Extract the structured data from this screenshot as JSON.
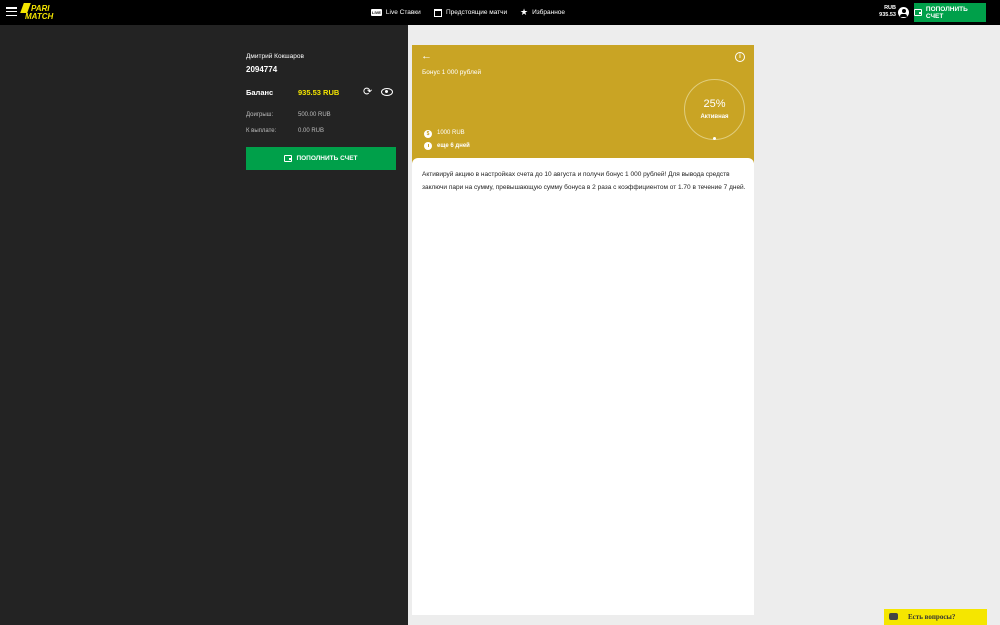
{
  "header": {
    "logo_line1": "PARI",
    "logo_line2": "MATCH",
    "nav": [
      {
        "label": "Live Ставки",
        "badge": "LIVE"
      },
      {
        "label": "Предстоящие матчи"
      },
      {
        "label": "Избранное"
      }
    ],
    "currency": "RUB",
    "balance": "935.53",
    "deposit_label": "ПОПОЛНИТЬ СЧЕТ"
  },
  "account": {
    "name": "Дмитрий Кокшаров",
    "id": "2094774",
    "balance_label": "Баланс",
    "balance_value": "935.53 RUB",
    "rows": [
      {
        "label": "Доигрыш:",
        "value": "500.00 RUB"
      },
      {
        "label": "К выплате:",
        "value": "0.00 RUB"
      }
    ],
    "deposit_label": "ПОПОЛНИТЬ СЧЕТ"
  },
  "bonus": {
    "title": "Бонус 1 000 рублей",
    "progress_percent": "25%",
    "status": "Активная",
    "amount": "1000 RUB",
    "time_left": "еще 6 дней",
    "description": "Активируй акцию в настройках счета до 10 августа и получи бонус 1 000 рублей! Для вывода средств заключи пари на сумму, превышающую сумму бонуса в 2 раза с коэффициентом от 1.70 в течение 7 дней."
  },
  "chat": {
    "label": "Есть вопросы?"
  },
  "colors": {
    "header_bg": "#000000",
    "panel_bg": "#232323",
    "accent_green": "#00a04a",
    "accent_yellow": "#f5e600",
    "bonus_gold": "#c9a424"
  },
  "icons": [
    "menu-icon",
    "live-icon",
    "calendar-icon",
    "star-icon",
    "user-icon",
    "wallet-icon",
    "refresh-icon",
    "eye-icon",
    "back-arrow-icon",
    "info-icon",
    "coin-icon",
    "timer-icon",
    "chat-icon"
  ]
}
